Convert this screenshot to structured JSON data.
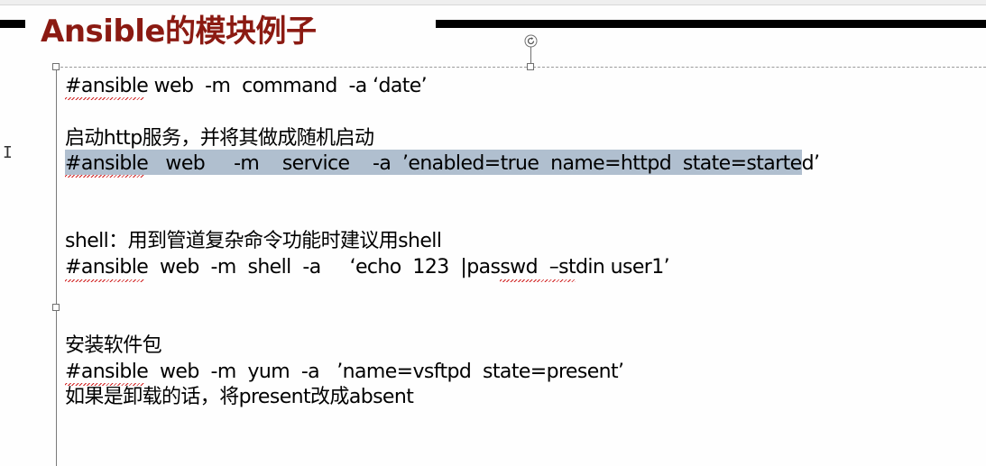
{
  "slide": {
    "title": "Ansible的模块例子",
    "lines": [
      "#ansible web  -m  command  -a ‘date’",
      "启动http服务，并将其做成随机启动",
      "#ansible   web     -m    service    -a  ’enabled=true  name=httpd  state=started’",
      "shell：用到管道复杂命令功能时建议用shell",
      "#ansible  web  -m  shell  -a     ‘echo  123  |passwd  –stdin user1’",
      "安装软件包",
      "#ansible  web  -m  yum  -a   ’name=vsftpd  state=present’",
      "如果是卸载的话，将present改成absent"
    ]
  },
  "colors": {
    "title": "#8b1a12",
    "selection": "#b0bfcf",
    "spellcheck": "#d02020"
  },
  "icons": {
    "rotate": "rotate-handle-icon",
    "cursor": "text-cursor-icon"
  }
}
